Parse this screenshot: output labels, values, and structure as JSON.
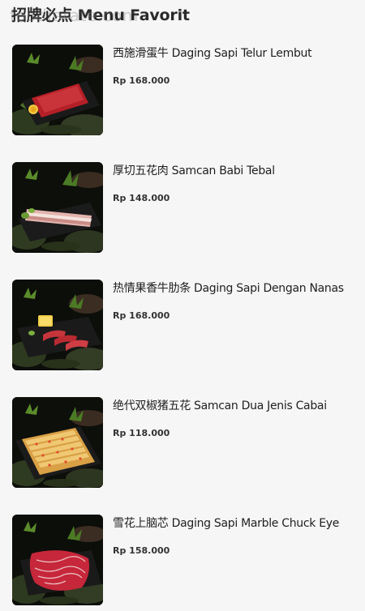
{
  "section": {
    "title": "招牌必点 Menu Favorit",
    "watermark": "foodierate.com"
  },
  "items": [
    {
      "name": "西施滑蛋牛 Daging Sapi Telur Lembut",
      "price": "Rp 168.000",
      "image_icon": "beef-with-egg-platter-photo"
    },
    {
      "name": "厚切五花肉 Samcan Babi Tebal",
      "price": "Rp 148.000",
      "image_icon": "pork-belly-platter-photo"
    },
    {
      "name": "热情果香牛肋条 Daging Sapi Dengan Nanas",
      "price": "Rp 168.000",
      "image_icon": "beef-rib-with-pineapple-platter-photo"
    },
    {
      "name": "绝代双椒猪五花 Samcan Dua Jenis Cabai",
      "price": "Rp 118.000",
      "image_icon": "chili-pork-belly-platter-photo"
    },
    {
      "name": "雪花上脑芯 Daging Sapi Marble Chuck Eye",
      "price": "Rp 158.000",
      "image_icon": "marbled-beef-platter-photo"
    }
  ]
}
